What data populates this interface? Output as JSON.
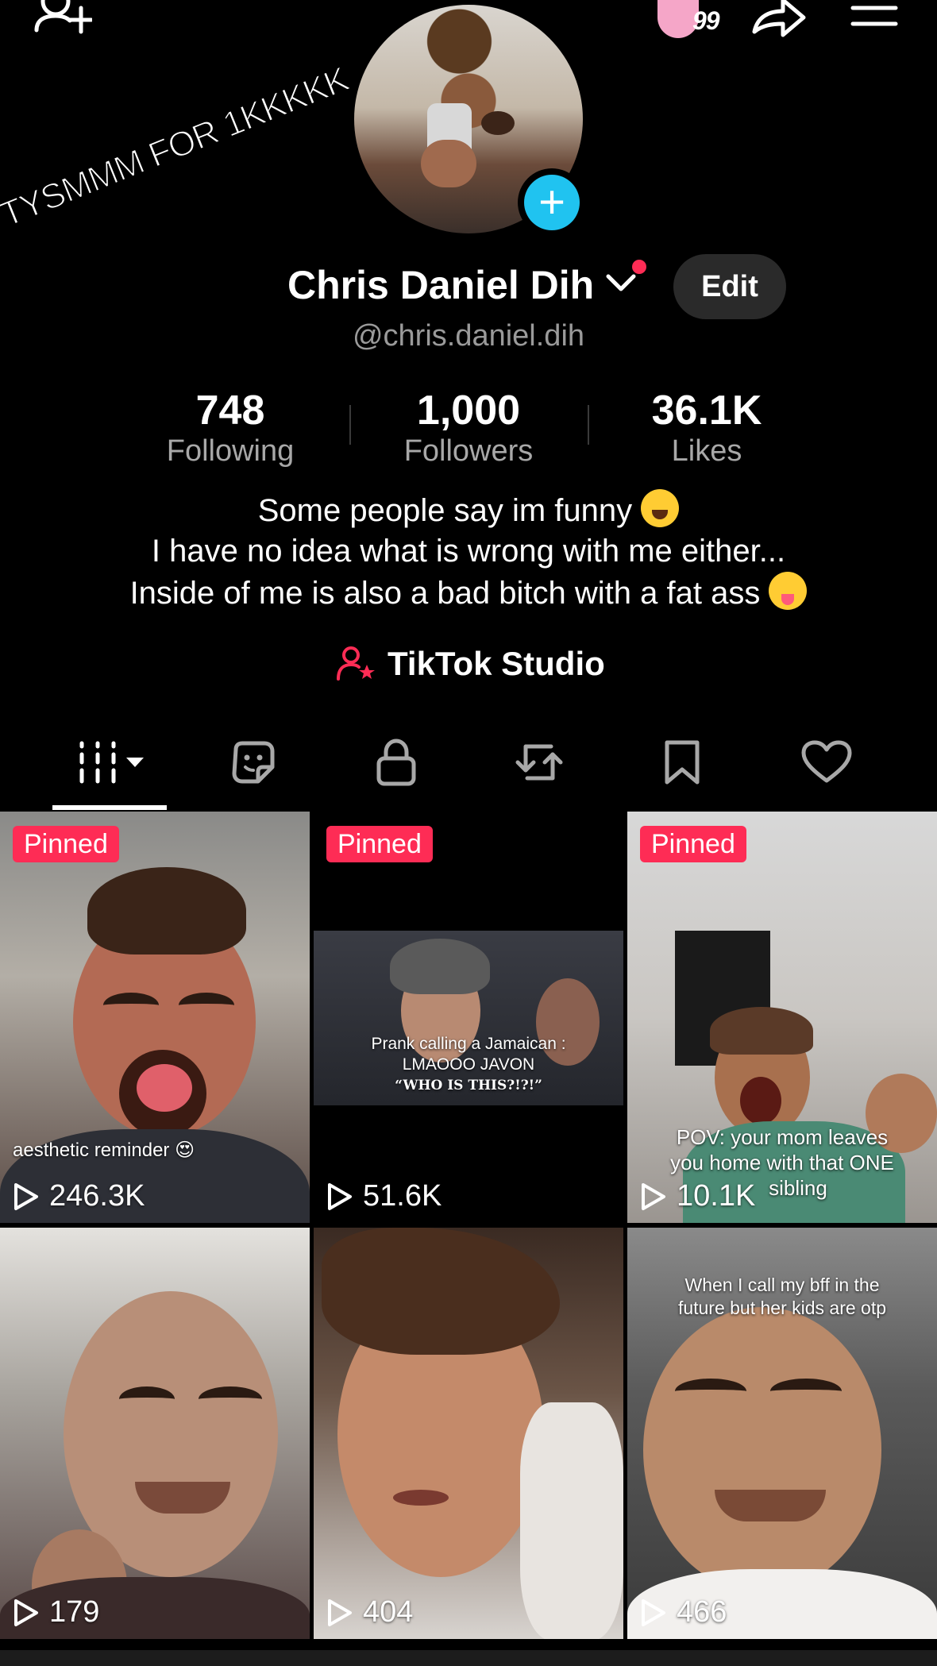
{
  "header": {
    "add_friend_icon": "person-plus-icon",
    "inbox_count": "99",
    "share_icon": "share-arrow-icon",
    "menu_icon": "hamburger-menu-icon",
    "sticker_text": "TYSMMM FOR 1KKKKK"
  },
  "profile": {
    "name": "Chris Daniel Dih",
    "handle": "@chris.daniel.dih",
    "edit_label": "Edit",
    "stats": [
      {
        "value": "748",
        "label": "Following"
      },
      {
        "value": "1,000",
        "label": "Followers"
      },
      {
        "value": "36.1K",
        "label": "Likes"
      }
    ],
    "bio": [
      "Some people say im funny",
      "I have no idea what is wrong with me either...",
      "Inside of me is also a bad bitch with a fat ass"
    ],
    "studio_label": "TikTok Studio"
  },
  "tabs": [
    {
      "name": "videos",
      "icon": "grid-icon",
      "active": true
    },
    {
      "name": "stickers",
      "icon": "sticker-icon"
    },
    {
      "name": "private",
      "icon": "lock-icon"
    },
    {
      "name": "reposts",
      "icon": "repost-icon"
    },
    {
      "name": "favorites",
      "icon": "bookmark-icon"
    },
    {
      "name": "liked",
      "icon": "heart-icon"
    }
  ],
  "videos": [
    {
      "pinned": "Pinned",
      "caption": "aesthetic reminder 😍",
      "views": "246.3K"
    },
    {
      "pinned": "Pinned",
      "caption_lines": [
        "Prank calling a Jamaican :",
        "LMAOOO JAVON",
        "“WHO IS THIS?!?!”"
      ],
      "views": "51.6K"
    },
    {
      "pinned": "Pinned",
      "caption_lines": [
        "POV: your mom leaves",
        "you home with that ONE",
        "sibling"
      ],
      "views": "10.1K"
    },
    {
      "views": "179"
    },
    {
      "views": "404"
    },
    {
      "caption_lines": [
        "When I call my bff in the",
        "future but her kids are otp"
      ],
      "views": "466"
    }
  ],
  "colors": {
    "accent": "#fe2c55",
    "avatar_add": "#20c3f0",
    "background": "#000000"
  }
}
